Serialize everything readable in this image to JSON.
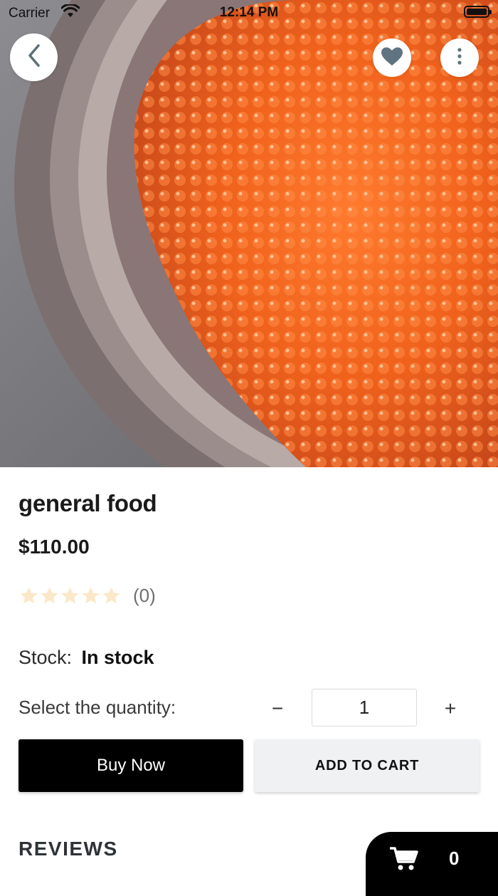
{
  "status_bar": {
    "carrier": "Carrier",
    "time": "12:14 PM"
  },
  "hero": {
    "image_description_icon": "product-photo-icon"
  },
  "actions": {
    "back_icon": "chevron-left-icon",
    "favorite_icon": "heart-icon",
    "more_icon": "more-vertical-icon"
  },
  "product": {
    "name": "general food",
    "price": "$110.00",
    "rating_count": "(0)",
    "stars": 0,
    "star_max": 5,
    "stock_label": "Stock:",
    "stock_value": "In stock"
  },
  "quantity": {
    "label": "Select the quantity:",
    "minus": "−",
    "plus": "+",
    "value": "1"
  },
  "buttons": {
    "buy_now": "Buy Now",
    "add_to_cart": "ADD TO CART"
  },
  "reviews": {
    "heading": "REVIEWS"
  },
  "cart": {
    "count": "0"
  },
  "colors": {
    "primary": "#000000",
    "secondary_button_bg": "#f0f1f3",
    "star_empty": "#fbe8c8",
    "accent_roe": "#f2641e"
  }
}
